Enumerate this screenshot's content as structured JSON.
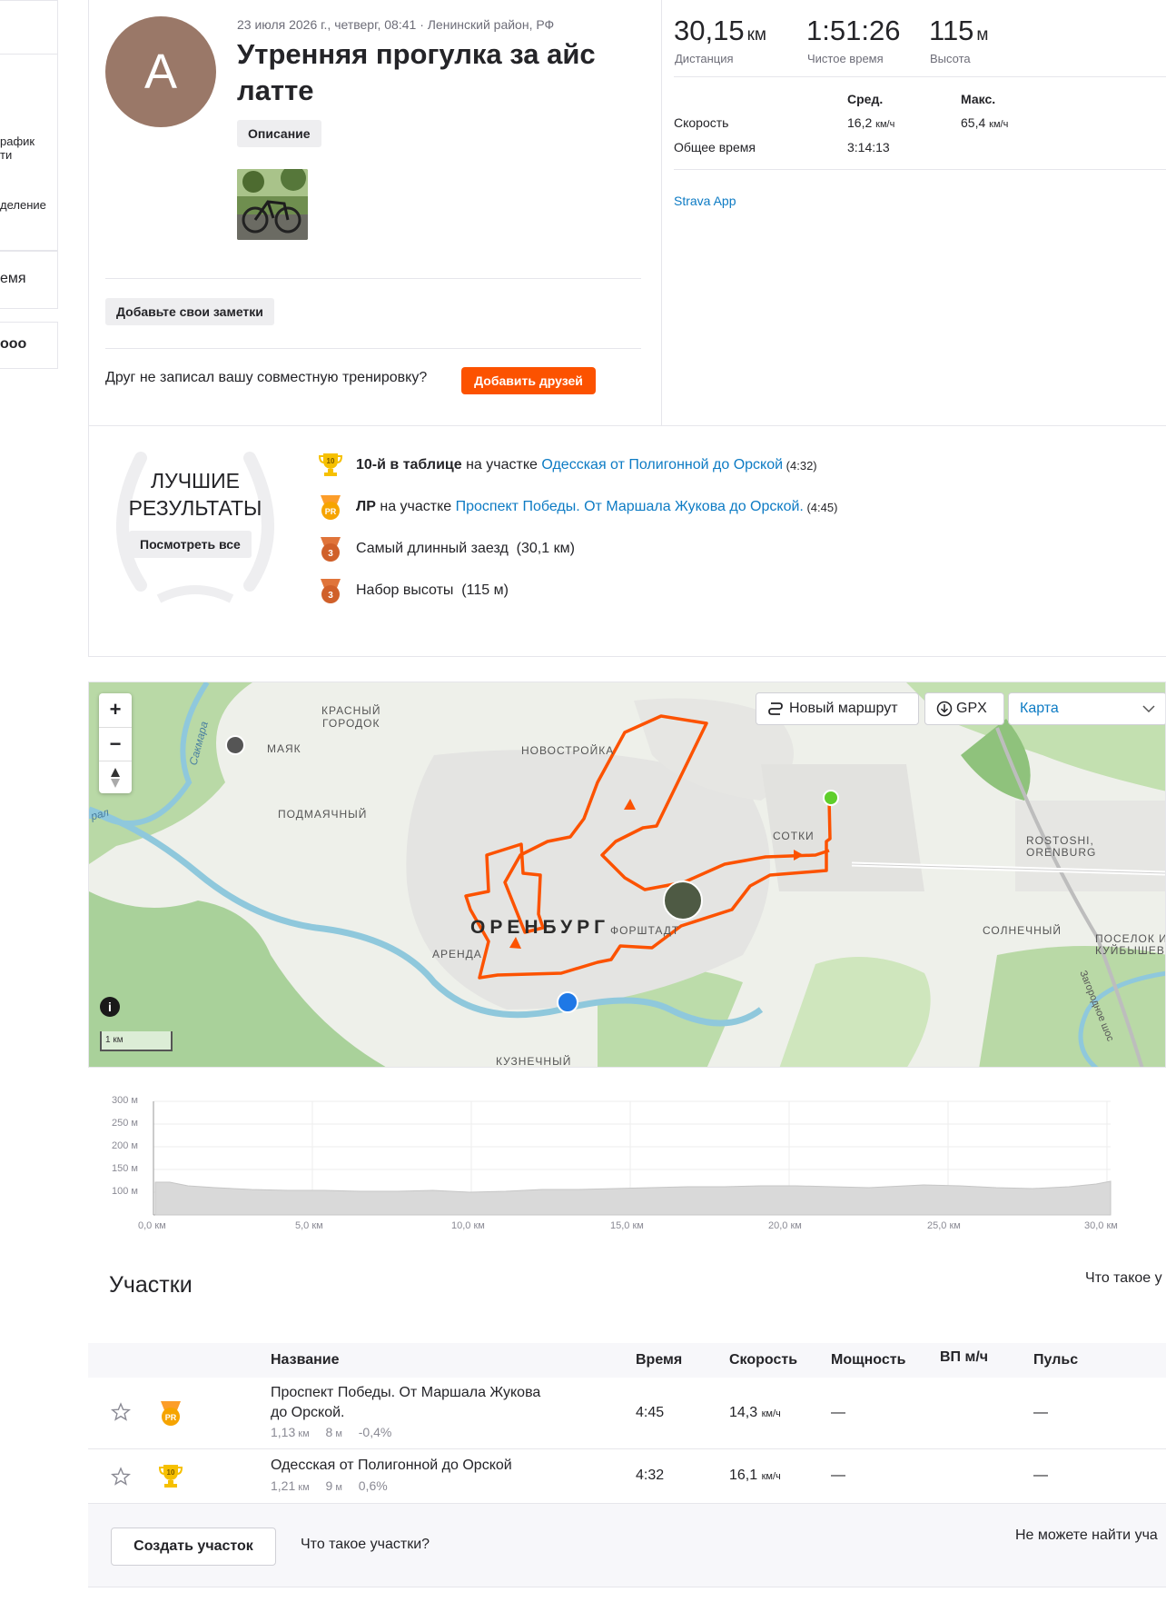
{
  "sidebar": {
    "item1_line1": "рафик",
    "item1_line2": "ти",
    "item2_line1": "деление",
    "item3": "емя",
    "item4": "ооо"
  },
  "activity": {
    "avatar_letter": "A",
    "meta": "23 июля 2026 г., четверг, 08:41 · Ленинский район, РФ",
    "title": "Утренняя прогулка за айс латте",
    "description_chip": "Описание",
    "notes_chip": "Добавьте свои заметки",
    "friend_prompt": "Друг не записал вашу совместную тренировку?",
    "add_friends_button": "Добавить друзей"
  },
  "stats": {
    "distance_value": "30,15",
    "distance_unit": "км",
    "distance_label": "Дистанция",
    "moving_time_value": "1:51:26",
    "moving_time_label": "Чистое время",
    "elevation_value": "115",
    "elevation_unit": "м",
    "elevation_label": "Высота",
    "col_avg": "Сред.",
    "col_max": "Макс.",
    "speed_label": "Скорость",
    "speed_avg": "16,2",
    "speed_max": "65,4",
    "speed_unit": "км/ч",
    "total_time_label": "Общее время",
    "total_time_value": "3:14:13",
    "app_link": "Strava App"
  },
  "achievements": {
    "title": "ЛУЧШИЕ РЕЗУЛЬТАТЫ",
    "see_all": "Посмотреть все",
    "items": [
      {
        "bold": "10-й в таблице",
        "text": " на участке ",
        "link": "Одесская от Полигонной до Орской",
        "small": " (4:32)"
      },
      {
        "bold": "ЛР",
        "text": " на участке ",
        "link": "Проспект Победы. От Маршала Жукова до Орской.",
        "small": " (4:45)"
      },
      {
        "bold": "",
        "text": "Самый длинный заезд  (30,1 км)",
        "link": "",
        "small": ""
      },
      {
        "bold": "",
        "text": "Набор высоты  (115 м)",
        "link": "",
        "small": ""
      }
    ]
  },
  "map": {
    "new_route": "Новый маршрут",
    "gpx": "GPX",
    "map_type": "Карта",
    "scale": "1 км",
    "labels": {
      "krasny1": "КРАСНЫЙ",
      "krasny2": "ГОРОДОК",
      "mayak": "МАЯК",
      "novostroyka": "НОВОСТРОЙКА",
      "podmayachny": "ПОДМАЯЧНЫЙ",
      "sotki": "СОТКИ",
      "rostoshi1": "ROSTOSHI,",
      "rostoshi2": "ORENBURG",
      "city": "ОРЕНБУРГ",
      "forshtadt": "ФОРШТАДТ",
      "arenda": "АРЕНДА",
      "solnechny": "СОЛНЕЧНЫЙ",
      "poselok1": "ПОСЕЛОК И",
      "poselok2": "КУЙБЫШЕВ",
      "kuznechny": "КУЗНЕЧНЫЙ",
      "sakmara": "Сакмара",
      "ural": "рал",
      "zagorodnoe": "Загородное шос"
    }
  },
  "elevation_chart": {
    "y_ticks": [
      "300 м",
      "250 м",
      "200 м",
      "150 м",
      "100 м"
    ],
    "x_ticks": [
      "0,0 км",
      "5,0 км",
      "10,0 км",
      "15,0 км",
      "20,0 км",
      "25,0 км",
      "30,0 км"
    ]
  },
  "segments": {
    "title": "Участки",
    "what_is_top": "Что такое у",
    "headers": {
      "name": "Название",
      "time": "Время",
      "speed": "Скорость",
      "power": "Мощность",
      "vam": "ВП м/ч",
      "hr": "Пульс"
    },
    "rows": [
      {
        "name_line1": "Проспект Победы. От Маршала Жукова",
        "name_line2": "до Орской.",
        "dist": "1,13",
        "dist_unit": "км",
        "elev": "8",
        "elev_unit": "м",
        "grade": "-0,4%",
        "time": "4:45",
        "speed": "14,3",
        "speed_unit": "км/ч",
        "power": "—",
        "hr": "—",
        "badge": "PR"
      },
      {
        "name_line1": "Одесская от Полигонной до Орской",
        "name_line2": "",
        "dist": "1,21",
        "dist_unit": "км",
        "elev": "9",
        "elev_unit": "м",
        "grade": "0,6%",
        "time": "4:32",
        "speed": "16,1",
        "speed_unit": "км/ч",
        "power": "—",
        "hr": "—",
        "badge": "10"
      }
    ],
    "create_button": "Создать участок",
    "what_is": "Что такое участки?",
    "cant_find": "Не можете найти уча"
  }
}
